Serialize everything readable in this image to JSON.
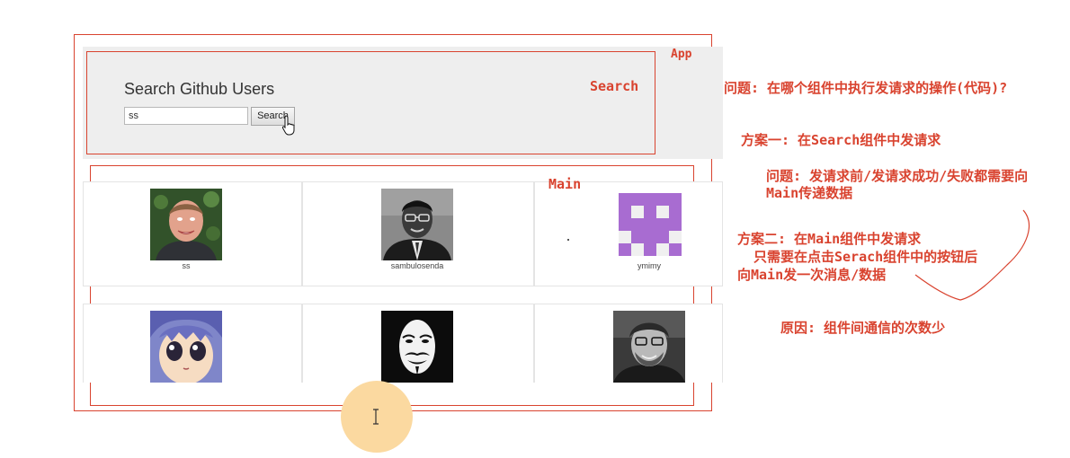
{
  "labels": {
    "app": "App",
    "search": "Search",
    "main": "Main"
  },
  "search": {
    "title": "Search Github Users",
    "input_value": "ss",
    "button_label": "Search"
  },
  "users": [
    {
      "login": "ss"
    },
    {
      "login": "sambulosenda"
    },
    {
      "login": "ymimy"
    },
    {
      "login": ""
    },
    {
      "login": ""
    },
    {
      "login": ""
    }
  ],
  "notes": {
    "question": "问题: 在哪个组件中执行发请求的操作(代码)?",
    "plan1": "方案一: 在Search组件中发请求",
    "plan1_issue_line1": "问题: 发请求前/发请求成功/失败都需要向",
    "plan1_issue_line2": "Main传递数据",
    "plan2_line1": "方案二: 在Main组件中发请求",
    "plan2_line2": "只需要在点击Serach组件中的按钮后",
    "plan2_line3": "向Main发一次消息/数据",
    "reason": "原因: 组件间通信的次数少"
  },
  "colors": {
    "annotation_red": "#d9432f",
    "panel_gray": "#eeeeee",
    "cursor_highlight": "#fbd9a0"
  }
}
